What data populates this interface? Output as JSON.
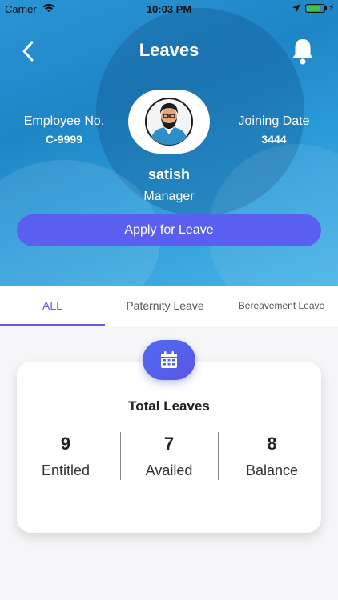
{
  "status_bar": {
    "carrier": "Carrier",
    "time": "10:03 PM",
    "battery_level": 0.8
  },
  "header": {
    "title": "Leaves",
    "back_icon": "chevron-left-icon",
    "notification_icon": "bell-icon"
  },
  "profile": {
    "employee_label": "Employee No.",
    "employee_value": "C-9999",
    "joining_label": "Joining Date",
    "joining_value": "3444",
    "name": "satish",
    "role": "Manager"
  },
  "apply_button": {
    "label": "Apply for Leave"
  },
  "tabs": [
    {
      "label": "ALL",
      "selected": true
    },
    {
      "label": "Paternity Leave",
      "selected": false
    },
    {
      "label": "Bereavement Leave",
      "selected": false
    }
  ],
  "summary": {
    "icon": "calendar-icon",
    "title": "Total Leaves",
    "stats": [
      {
        "value": "9",
        "label": "Entitled"
      },
      {
        "value": "7",
        "label": "Availed"
      },
      {
        "value": "8",
        "label": "Balance"
      }
    ]
  },
  "colors": {
    "accent": "#5a5ff0",
    "tab_active": "#6a5ae0",
    "hero": "#1f86c6"
  }
}
